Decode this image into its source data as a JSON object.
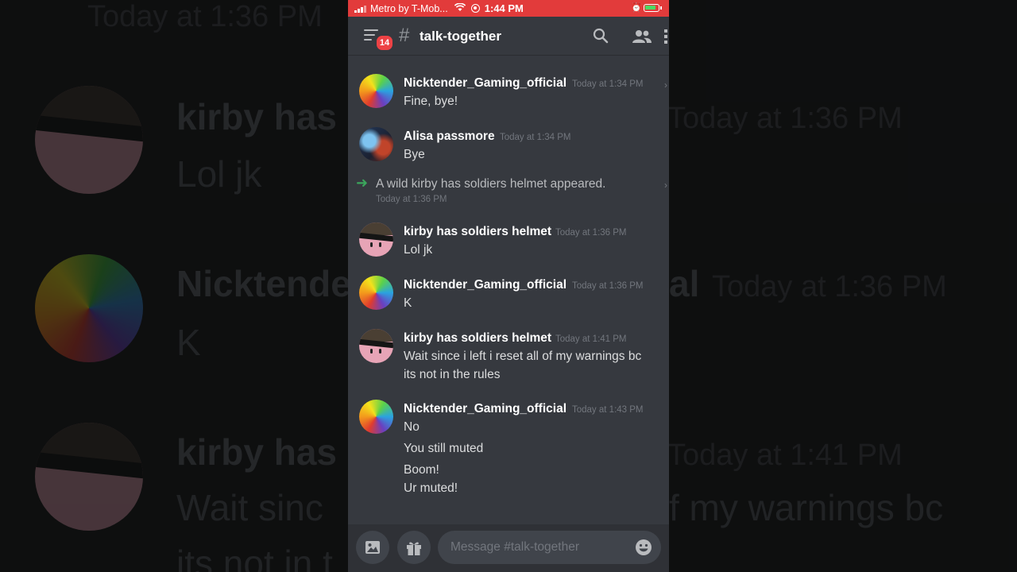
{
  "status_bar": {
    "carrier": "Metro by T-Mob...",
    "time": "1:44 PM",
    "bar_color": "#e23b3b"
  },
  "header": {
    "unread_badge": "14",
    "channel_hash": "#",
    "channel_name": "talk-together",
    "icons": [
      "menu-icon",
      "search-icon",
      "members-icon",
      "more-icon"
    ]
  },
  "messages": [
    {
      "author": "Nicktender_Gaming_official",
      "time": "Today at 1:34 PM",
      "lines": [
        "Fine, bye!"
      ],
      "avatar": "rainbow"
    },
    {
      "author": "Alisa passmore",
      "time": "Today at 1:34 PM",
      "lines": [
        "Bye"
      ],
      "avatar": "alisa"
    },
    {
      "system": true,
      "text": "A wild kirby has soldiers helmet appeared.",
      "time": "Today at 1:36 PM"
    },
    {
      "author": "kirby has soldiers helmet",
      "time": "Today at 1:36 PM",
      "lines": [
        "Lol jk"
      ],
      "avatar": "kirby"
    },
    {
      "author": "Nicktender_Gaming_official",
      "time": "Today at 1:36 PM",
      "lines": [
        "K"
      ],
      "avatar": "rainbow"
    },
    {
      "author": "kirby has soldiers helmet",
      "time": "Today at 1:41 PM",
      "lines": [
        "Wait since i left i reset all of my warnings bc",
        "its not in the rules"
      ],
      "avatar": "kirby"
    },
    {
      "author": "Nicktender_Gaming_official",
      "time": "Today at 1:43 PM",
      "lines": [
        "No",
        "You still muted",
        "Boom!",
        "Ur muted!"
      ],
      "avatar": "rainbow"
    }
  ],
  "input": {
    "placeholder": "Message #talk-together",
    "buttons": [
      "image-icon",
      "gift-icon",
      "emoji-icon"
    ]
  },
  "background": {
    "time_top": "Today at 1:36 PM",
    "row1_name": "kirby has",
    "row1_text": "Lol jk",
    "row1_time": "Today at 1:36 PM",
    "row2_name": "Nicktende",
    "row2_suffix": "al",
    "row2_time": "Today at 1:36 PM",
    "row2_text": "K",
    "row3_name": "kirby has",
    "row3_time": "Today at 1:41 PM",
    "row3_text_left": "Wait sinc",
    "row3_text_right": "f my warnings bc",
    "row4_text": "its not in t"
  },
  "colors": {
    "chat_bg": "#36393f",
    "input_bar_bg": "#2f3136",
    "badge": "#ed4245",
    "join_arrow": "#3ba55c",
    "username": "#ffffff",
    "message_text": "#dcddde",
    "timestamp": "#72767d"
  }
}
